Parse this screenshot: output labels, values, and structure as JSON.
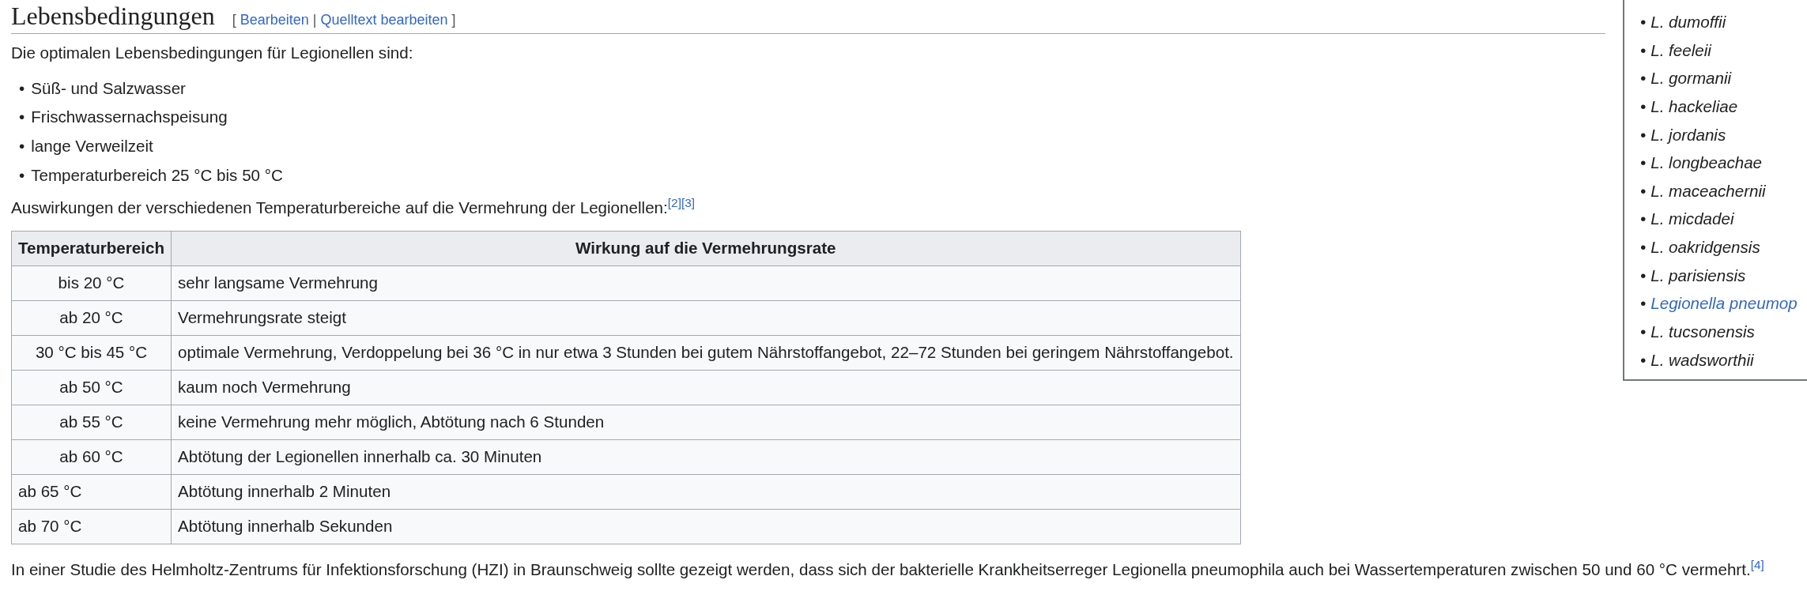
{
  "section": {
    "title": "Lebensbedingungen",
    "edit_links": {
      "open": "[",
      "separator": "|",
      "close": "]",
      "links": [
        "Bearbeiten",
        "Quelltext bearbeiten"
      ]
    }
  },
  "intro": "Die optimalen Lebensbedingungen für Legionellen sind:",
  "bullet": "•",
  "conditions": [
    "Süß- und Salzwasser",
    "Frischwassernachspeisung",
    "lange Verweilzeit",
    "Temperaturbereich 25 °C bis 50 °C"
  ],
  "table_intro": {
    "text": "Auswirkungen der verschiedenen Temperaturbereiche auf die Vermehrung der Legionellen:",
    "refs": [
      "[2]",
      "[3]"
    ]
  },
  "table": {
    "columns": [
      "Temperaturbereich",
      "Wirkung auf die Vermehrungsrate"
    ],
    "rows": [
      {
        "range": "bis 20 °C",
        "effect": "sehr langsame Vermehrung",
        "kind": "centered"
      },
      {
        "range": "ab 20 °C",
        "effect": "Vermehrungsrate steigt",
        "kind": "centered"
      },
      {
        "range": "30 °C bis 45 °C",
        "effect": "optimale Vermehrung, Verdoppelung bei 36 °C in nur etwa 3 Stunden bei gutem Nährstoffangebot, 22–72 Stunden bei geringem Nährstoffangebot.",
        "kind": "centered"
      },
      {
        "range": "ab 50 °C",
        "effect": "kaum noch Vermehrung",
        "kind": "centered"
      },
      {
        "range": "ab 55 °C",
        "effect": "keine Vermehrung mehr möglich, Abtötung nach 6 Stunden",
        "kind": "centered"
      },
      {
        "range": "ab 60 °C",
        "effect": "Abtötung der Legionellen innerhalb ca. 30 Minuten",
        "kind": "centered"
      },
      {
        "range": "ab 65 °C",
        "effect": "Abtötung innerhalb 2 Minuten",
        "kind": "plain"
      },
      {
        "range": "ab 70 °C",
        "effect": "Abtötung innerhalb Sekunden",
        "kind": "plain"
      }
    ]
  },
  "study": {
    "text": "In einer Studie des Helmholtz-Zentrums für Infektionsforschung (HZI) in Braunschweig sollte gezeigt werden, dass sich der bakterielle Krankheitserreger Legionella pneumophila auch bei Wassertemperaturen zwischen 50 und 60 °C vermehrt.",
    "refs": [
      "[4]"
    ]
  },
  "species_list": {
    "items": [
      {
        "name": "L. dumoffii",
        "link": false
      },
      {
        "name": "L. feeleii",
        "link": false
      },
      {
        "name": "L. gormanii",
        "link": false
      },
      {
        "name": "L. hackeliae",
        "link": false
      },
      {
        "name": "L. jordanis",
        "link": false
      },
      {
        "name": "L. longbeachae",
        "link": false
      },
      {
        "name": "L. maceachernii",
        "link": false
      },
      {
        "name": "L. micdadei",
        "link": false
      },
      {
        "name": "L. oakridgensis",
        "link": false
      },
      {
        "name": "L. parisiensis",
        "link": false
      },
      {
        "name": "Legionella pneumop",
        "link": true
      },
      {
        "name": "L. tucsonensis",
        "link": false
      },
      {
        "name": "L. wadsworthii",
        "link": false
      }
    ]
  }
}
